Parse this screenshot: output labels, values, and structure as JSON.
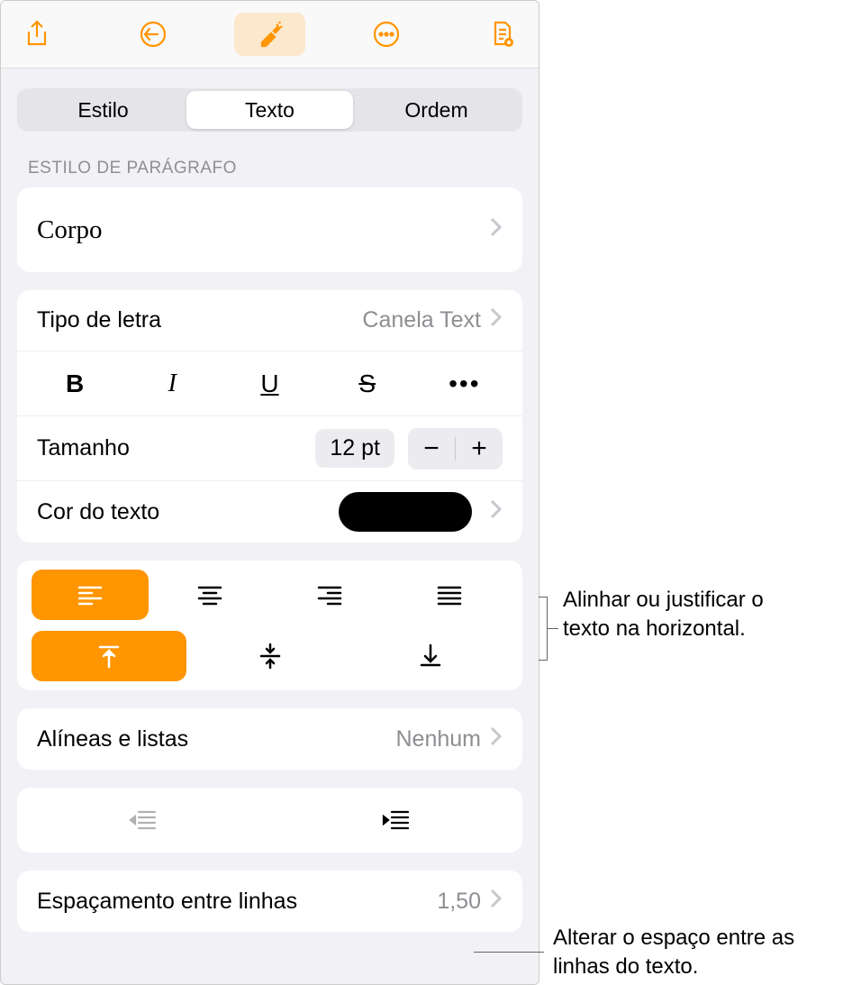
{
  "toolbar": {
    "share_icon": "share",
    "undo_icon": "undo",
    "format_icon": "format-brush",
    "more_icon": "more",
    "doc_icon": "document"
  },
  "tabs": {
    "style": "Estilo",
    "text": "Texto",
    "order": "Ordem"
  },
  "paragraph_style": {
    "title": "ESTILO DE PARÁGRAFO",
    "value": "Corpo"
  },
  "font": {
    "label": "Tipo de letra",
    "value": "Canela Text",
    "bold": "B",
    "italic": "I",
    "underline": "U",
    "strike": "S"
  },
  "size": {
    "label": "Tamanho",
    "value": "12 pt"
  },
  "color": {
    "label": "Cor do texto"
  },
  "bullets": {
    "label": "Alíneas e listas",
    "value": "Nenhum"
  },
  "line_spacing": {
    "label": "Espaçamento entre linhas",
    "value": "1,50"
  },
  "callouts": {
    "align": "Alinhar ou justificar o texto na horizontal.",
    "spacing": "Alterar o espaço entre as linhas do texto."
  },
  "colors": {
    "accent": "#ff9500"
  }
}
